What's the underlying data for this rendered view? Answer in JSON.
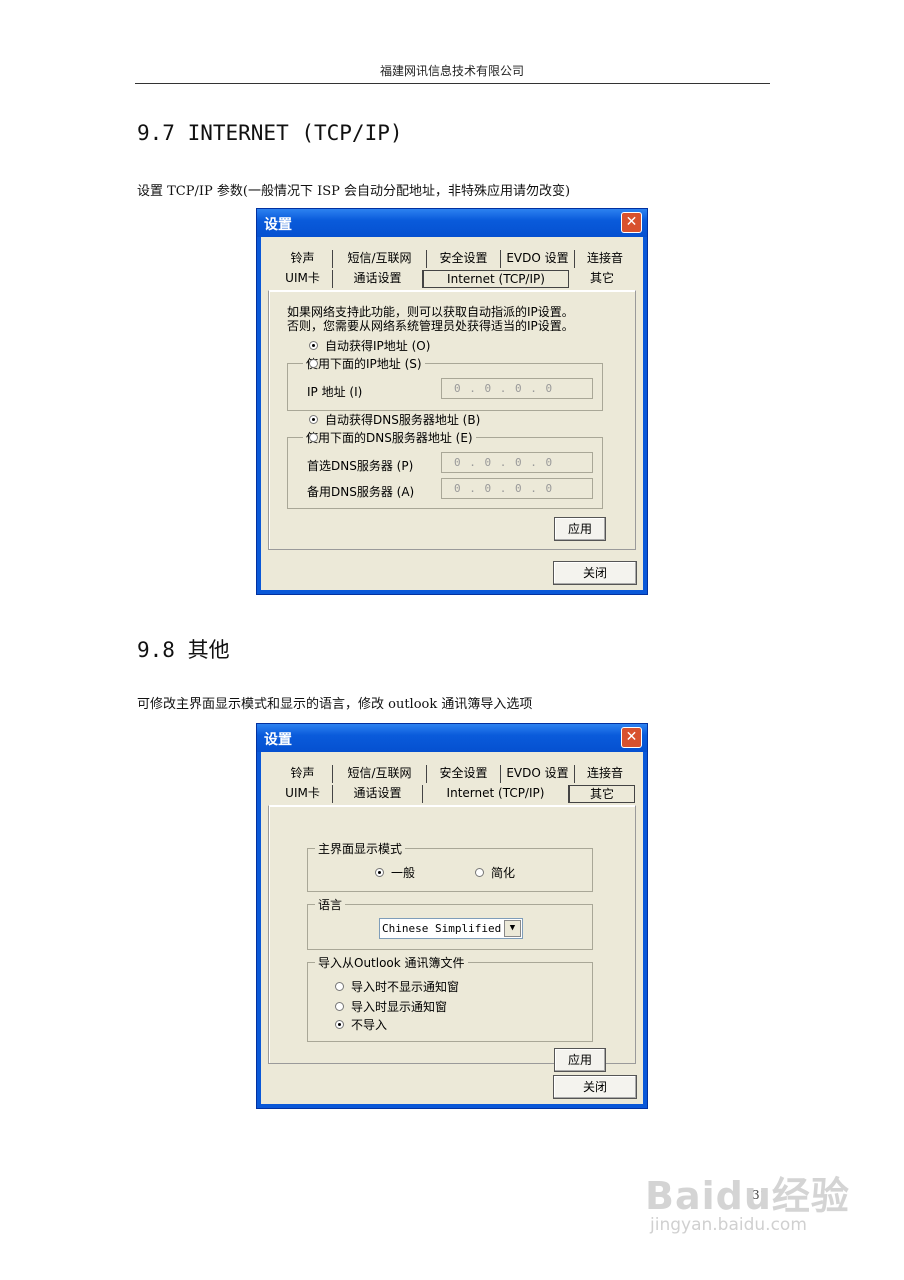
{
  "header": {
    "company": "福建网讯信息技术有限公司"
  },
  "section1": {
    "title": "9.7 INTERNET (TCP/IP)",
    "desc": "设置 TCP/IP 参数(一般情况下 ISP 会自动分配地址，非特殊应用请勿改变)"
  },
  "section2": {
    "title": "9.8 其他",
    "desc": "可修改主界面显示模式和显示的语言，修改 outlook 通讯簿导入选项"
  },
  "dialog1": {
    "title": "设置",
    "close_glyph": "✕",
    "tabs_row1": [
      "铃声",
      "短信/互联网",
      "安全设置",
      "EVDO 设置",
      "连接音"
    ],
    "tabs_row2": [
      "UIM卡",
      "通话设置",
      "Internet (TCP/IP)",
      "其它"
    ],
    "info_line1": "如果网络支持此功能，则可以获取自动指派的IP设置。",
    "info_line2": "否则，您需要从网络系统管理员处获得适当的IP设置。",
    "auto_ip": "自动获得IP地址 (O)",
    "manual_ip": "使用下面的IP地址 (S)",
    "ip_label": "IP 地址 (I)",
    "ip_value": "0 . 0 . 0 . 0",
    "auto_dns": "自动获得DNS服务器地址 (B)",
    "manual_dns": "使用下面的DNS服务器地址 (E)",
    "dns1_label": "首选DNS服务器 (P)",
    "dns1_value": "0 . 0 . 0 . 0",
    "dns2_label": "备用DNS服务器 (A)",
    "dns2_value": "0 . 0 . 0 . 0",
    "apply_label": "应用",
    "close_label": "关闭"
  },
  "dialog2": {
    "title": "设置",
    "close_glyph": "✕",
    "tabs_row1": [
      "铃声",
      "短信/互联网",
      "安全设置",
      "EVDO 设置",
      "连接音"
    ],
    "tabs_row2": [
      "UIM卡",
      "通话设置",
      "Internet (TCP/IP)",
      "其它"
    ],
    "mode_group": "主界面显示模式",
    "mode_normal": "一般",
    "mode_simple": "简化",
    "lang_group": "语言",
    "lang_value": "Chinese Simplified",
    "lang_arrow": "▼",
    "import_group": "导入从Outlook 通讯簿文件",
    "import_opt1": "导入时不显示通知窗",
    "import_opt2": "导入时显示通知窗",
    "import_opt3": "不导入",
    "apply_label": "应用",
    "close_label": "关闭"
  },
  "footer": {
    "page_number": "31",
    "watermark_logo": "Baidu经验",
    "watermark_url": "jingyan.baidu.com"
  }
}
